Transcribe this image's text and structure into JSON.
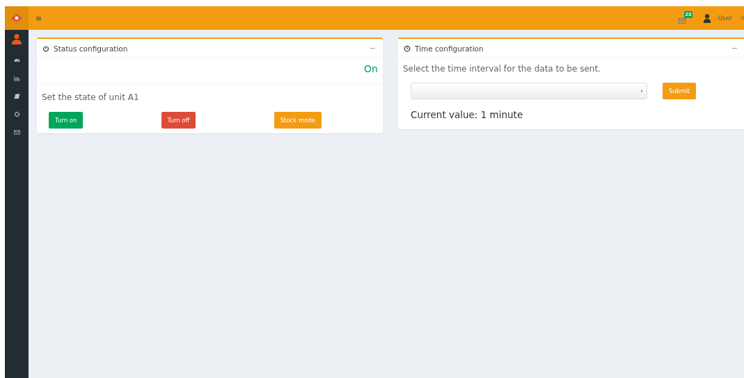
{
  "header": {
    "mail_badge": "23",
    "user": "User"
  },
  "panels": [
    {
      "kind": "status",
      "title": "Status configuration",
      "collapse": "−",
      "state": "On",
      "prompt": "Set the state of unit A1",
      "buttons": [
        {
          "label": "Turn on",
          "kind": "success"
        },
        {
          "label": "Turn off",
          "kind": "danger"
        },
        {
          "label": "Stock mode",
          "kind": "warning"
        }
      ]
    },
    {
      "kind": "time",
      "title": "Time configuration",
      "collapse": "−",
      "prompt": "Select the time interval for the data to be sent.",
      "submit": "Submit",
      "current": "Current value: 1 minute"
    }
  ]
}
